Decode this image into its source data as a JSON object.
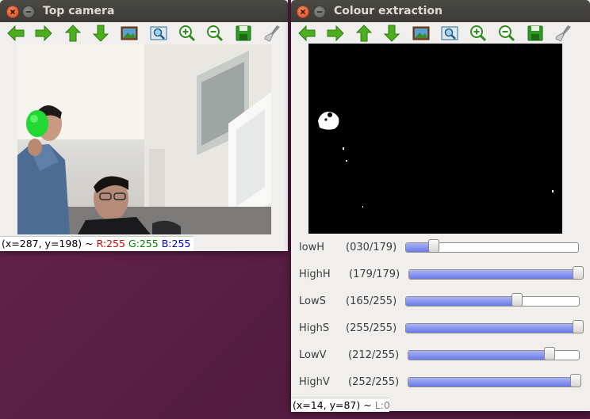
{
  "top_camera": {
    "title": "Top camera",
    "status": {
      "coords": "(x=287, y=198) ~ ",
      "r": "R:255",
      "g": "G:255",
      "b": "B:255"
    }
  },
  "colour_extraction": {
    "title": "Colour extraction",
    "sliders": [
      {
        "label": "lowH",
        "value": "(030/179)",
        "fraction": 0.168
      },
      {
        "label": "HighH",
        "value": "(179/179)",
        "fraction": 1.0
      },
      {
        "label": "LowS",
        "value": "(165/255)",
        "fraction": 0.647
      },
      {
        "label": "HighS",
        "value": "(255/255)",
        "fraction": 1.0
      },
      {
        "label": "LowV",
        "value": "(212/255)",
        "fraction": 0.831
      },
      {
        "label": "HighV",
        "value": "(252/255)",
        "fraction": 0.988
      }
    ],
    "status": {
      "coords": "(x=14, y=87) ~ ",
      "l": "L:0"
    }
  },
  "toolbar_icons": [
    "arrow-left-icon",
    "arrow-right-icon",
    "arrow-up-icon",
    "arrow-down-icon",
    "image-icon",
    "zoom-fit-icon",
    "zoom-in-icon",
    "zoom-out-icon",
    "save-icon",
    "brush-icon"
  ],
  "colors": {
    "arrow_green": "#4caf1f",
    "status_red": "#e00000",
    "status_green": "#008800",
    "status_blue": "#0000e0",
    "slider_fill": "#7b88ea",
    "desktop": "#5c2146"
  }
}
